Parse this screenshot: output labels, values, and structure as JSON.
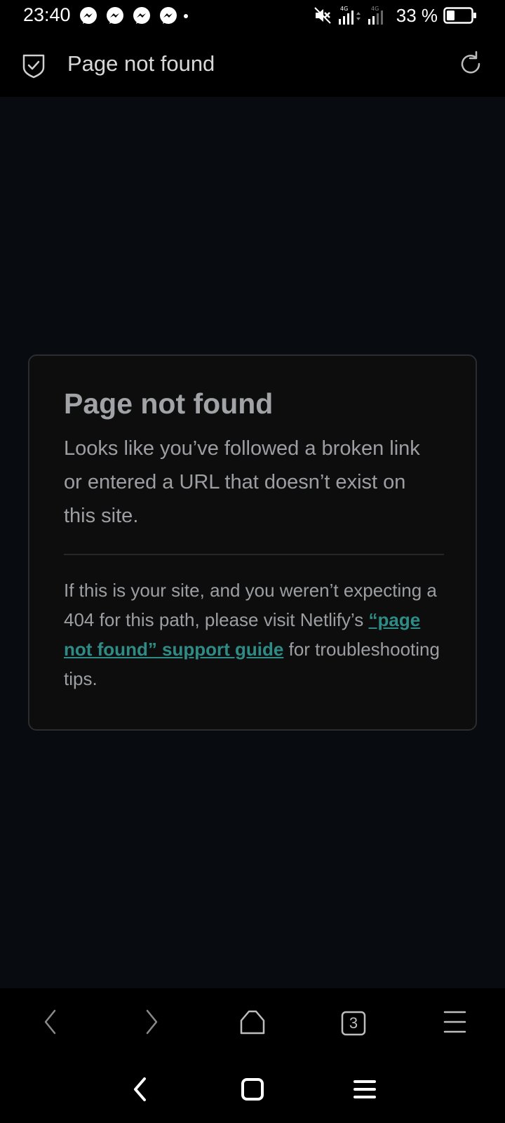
{
  "status_bar": {
    "time": "23:40",
    "notification_icons": [
      "messenger-icon",
      "messenger-icon",
      "messenger-icon",
      "messenger-icon"
    ],
    "network_label_1": "4G",
    "network_label_2": "4G",
    "battery_text": "33 %",
    "battery_level": 0.33
  },
  "address_bar": {
    "title": "Page not found"
  },
  "card": {
    "title": "Page not found",
    "description": "Looks like you’ve followed a broken link or entered a URL that doesn’t exist on this site.",
    "help_before": "If this is your site, and you weren’t expecting a 404 for this path, please visit Netlify’s ",
    "help_link": "“page not found” support guide",
    "help_after": " for troubleshooting tips."
  },
  "toolbar": {
    "tab_count": "3"
  },
  "colors": {
    "background": "#080b0f",
    "card_background": "#0d0d0e",
    "link": "#2f8b85",
    "text": "#9c9ea1"
  }
}
